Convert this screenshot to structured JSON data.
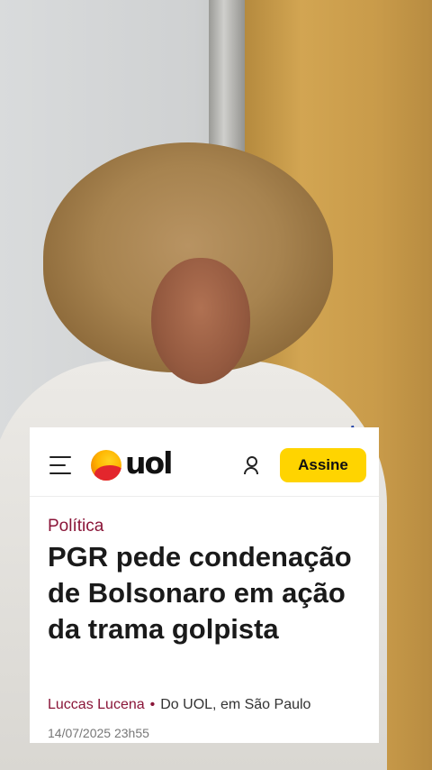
{
  "header": {
    "logo_text": "uol",
    "subscribe_label": "Assine"
  },
  "article": {
    "section": "Política",
    "headline": "PGR pede condenação de Bolsonaro em ação da trama golpista",
    "author": "Luccas Lucena",
    "source": "Do UOL, em São Paulo",
    "timestamp": "14/07/2025 23h55"
  },
  "icons": [
    "menu-icon",
    "uol-logo-icon",
    "user-icon"
  ],
  "colors": {
    "accent": "#8a1538",
    "subscribe_button": "#ffd400",
    "card_background": "#ffffff"
  }
}
